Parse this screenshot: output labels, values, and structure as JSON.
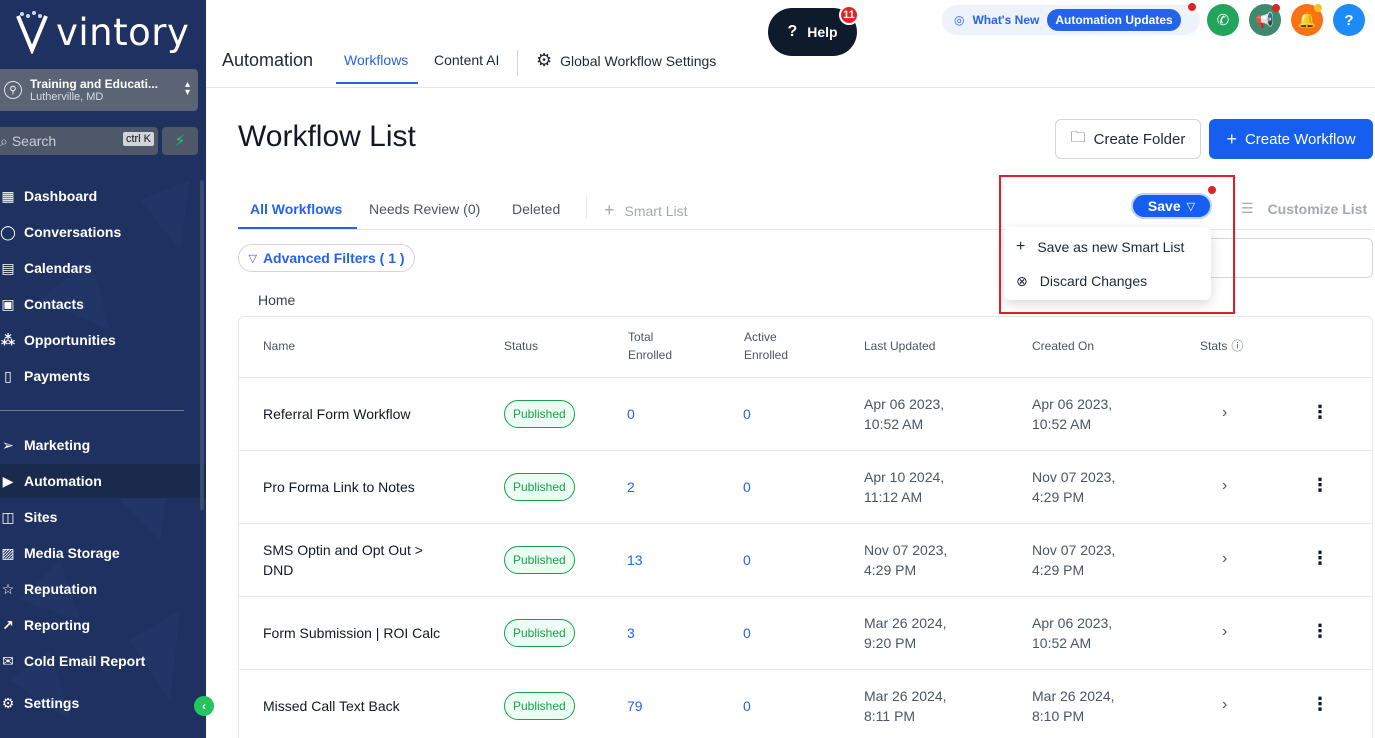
{
  "brand": {
    "logo_text": "vintory"
  },
  "account": {
    "name": "Training and Educati...",
    "location": "Lutherville, MD"
  },
  "search": {
    "placeholder": "Search",
    "shortcut": "ctrl K"
  },
  "sidebar": {
    "items": [
      {
        "label": "Dashboard",
        "icon": "dashboard-icon"
      },
      {
        "label": "Conversations",
        "icon": "chat-icon"
      },
      {
        "label": "Calendars",
        "icon": "calendar-icon"
      },
      {
        "label": "Contacts",
        "icon": "contacts-icon"
      },
      {
        "label": "Opportunities",
        "icon": "opportunities-icon"
      },
      {
        "label": "Payments",
        "icon": "payments-icon"
      },
      {
        "label": "Marketing",
        "icon": "send-icon"
      },
      {
        "label": "Automation",
        "icon": "play-icon",
        "active": true
      },
      {
        "label": "Sites",
        "icon": "globe-icon"
      },
      {
        "label": "Media Storage",
        "icon": "image-icon"
      },
      {
        "label": "Reputation",
        "icon": "star-icon"
      },
      {
        "label": "Reporting",
        "icon": "chart-icon"
      },
      {
        "label": "Cold Email Report",
        "icon": "mail-icon"
      },
      {
        "label": "Settings",
        "icon": "gear-icon"
      }
    ]
  },
  "topbar": {
    "section": "Automation",
    "tabs": [
      "Workflows",
      "Content AI",
      "Global Workflow Settings"
    ],
    "help_label": "Help",
    "help_badge": "11",
    "whats_new": "What's New",
    "automation_updates": "Automation Updates"
  },
  "main": {
    "title": "Workflow List",
    "create_folder": "Create Folder",
    "create_workflow": "Create Workflow",
    "subtabs": [
      "All Workflows",
      "Needs Review (0)",
      "Deleted"
    ],
    "smart_list": "Smart List",
    "customize_list": "Customize List",
    "save_label": "Save",
    "dropdown": [
      "Save as new Smart List",
      "Discard Changes"
    ],
    "advanced_filters": "Advanced Filters ( 1 )",
    "breadcrumb": "Home"
  },
  "table": {
    "headers": [
      "Name",
      "Status",
      "Total\nEnrolled",
      "Active\nEnrolled",
      "Last Updated",
      "Created On",
      "Stats"
    ],
    "rows": [
      {
        "name": "Referral Form Workflow",
        "status": "Published",
        "total": "0",
        "active": "0",
        "updated": [
          "Apr 06 2023,",
          "10:52 AM"
        ],
        "created": [
          "Apr 06 2023,",
          "10:52 AM"
        ]
      },
      {
        "name": "Pro Forma Link to Notes",
        "status": "Published",
        "total": "2",
        "active": "0",
        "updated": [
          "Apr 10 2024,",
          "11:12 AM"
        ],
        "created": [
          "Nov 07 2023,",
          "4:29 PM"
        ]
      },
      {
        "name": "SMS Optin and Opt Out >",
        "name2": "DND",
        "status": "Published",
        "total": "13",
        "active": "0",
        "updated": [
          "Nov 07 2023,",
          "4:29 PM"
        ],
        "created": [
          "Nov 07 2023,",
          "4:29 PM"
        ]
      },
      {
        "name": "Form Submission | ROI Calc",
        "status": "Published",
        "total": "3",
        "active": "0",
        "updated": [
          "Mar 26 2024,",
          "9:20 PM"
        ],
        "created": [
          "Apr 06 2023,",
          "10:52 AM"
        ]
      },
      {
        "name": "Missed Call Text Back",
        "status": "Published",
        "total": "79",
        "active": "0",
        "updated": [
          "Mar 26 2024,",
          "8:11 PM"
        ],
        "created": [
          "Mar 26 2024,",
          "8:10 PM"
        ]
      }
    ]
  },
  "colors": {
    "sidebar": "#1e3160",
    "accent": "#155eef",
    "published": "#16a34a",
    "highlight": "#e11d2a"
  }
}
